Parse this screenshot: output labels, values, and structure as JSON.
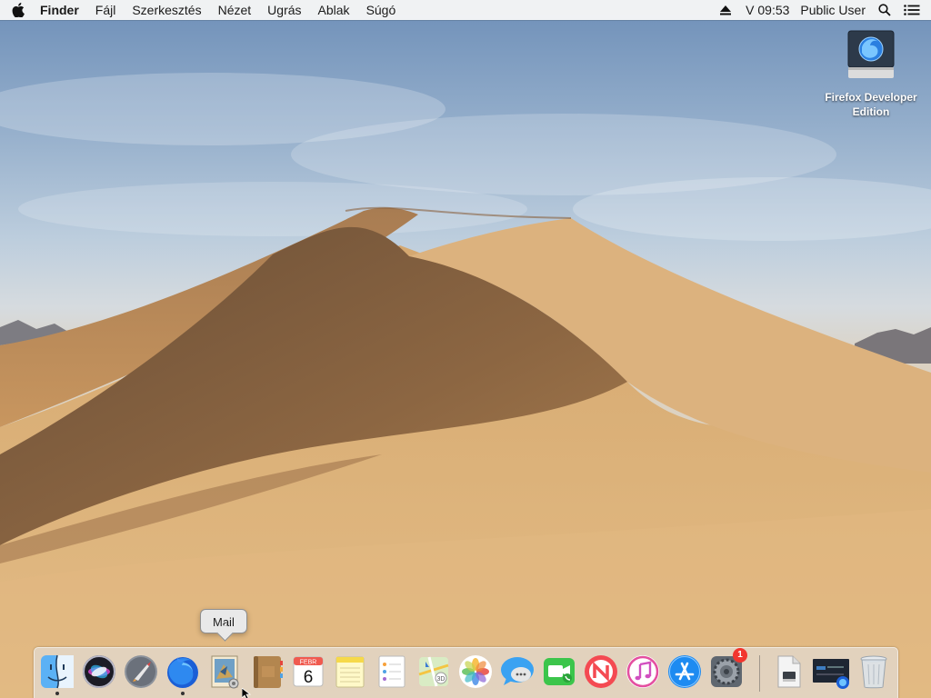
{
  "menubar": {
    "app_name": "Finder",
    "menus": [
      "Fájl",
      "Szerkesztés",
      "Nézet",
      "Ugrás",
      "Ablak",
      "Súgó"
    ],
    "clock": "V 09:53",
    "user": "Public User"
  },
  "desktop": {
    "icons": [
      {
        "label": "Firefox Developer Edition",
        "icon": "disk-image-firefox-icon"
      }
    ]
  },
  "tooltip": {
    "text": "Mail"
  },
  "dock": {
    "items": [
      {
        "name": "finder",
        "icon": "finder-icon",
        "running": true
      },
      {
        "name": "siri",
        "icon": "siri-icon",
        "running": false
      },
      {
        "name": "launchpad",
        "icon": "launchpad-icon",
        "running": false
      },
      {
        "name": "firefox",
        "icon": "firefox-icon",
        "running": true
      },
      {
        "name": "mail",
        "icon": "mail-icon",
        "running": false
      },
      {
        "name": "contacts",
        "icon": "contacts-icon",
        "running": false
      },
      {
        "name": "calendar",
        "icon": "calendar-icon",
        "running": false,
        "month": "FEBR",
        "day": "6"
      },
      {
        "name": "notes",
        "icon": "notes-icon",
        "running": false
      },
      {
        "name": "reminders",
        "icon": "reminders-icon",
        "running": false
      },
      {
        "name": "maps",
        "icon": "maps-icon",
        "running": false
      },
      {
        "name": "photos",
        "icon": "photos-icon",
        "running": false
      },
      {
        "name": "messages",
        "icon": "messages-icon",
        "running": false
      },
      {
        "name": "facetime",
        "icon": "facetime-icon",
        "running": false
      },
      {
        "name": "news",
        "icon": "news-icon",
        "running": false
      },
      {
        "name": "itunes",
        "icon": "itunes-icon",
        "running": false
      },
      {
        "name": "app-store",
        "icon": "app-store-icon",
        "running": false
      },
      {
        "name": "system-preferences",
        "icon": "system-preferences-icon",
        "running": false,
        "badge": "1"
      },
      {
        "name": "downloads",
        "icon": "downloads-stack-icon",
        "running": false
      },
      {
        "name": "firefox-installer",
        "icon": "firefox-installer-icon",
        "running": false
      },
      {
        "name": "trash",
        "icon": "trash-icon",
        "running": false
      }
    ]
  },
  "colors": {
    "sky_top": "#6e8fb8",
    "dune_light": "#d8ad74",
    "dune_shadow": "#7a5a3c",
    "menubar_bg": "#f6f6f6",
    "badge_red": "#f2352e"
  }
}
